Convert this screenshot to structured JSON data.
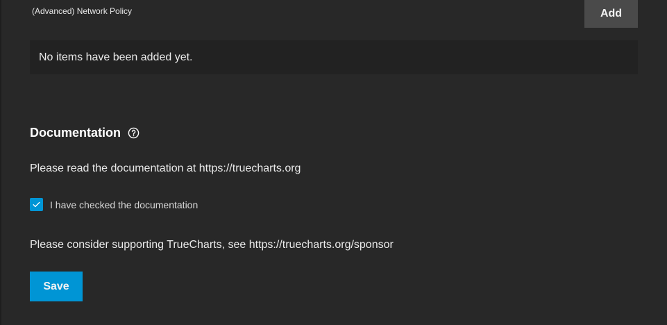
{
  "network_policy": {
    "label": "(Advanced) Network Policy",
    "add_label": "Add",
    "empty_message": "No items have been added yet."
  },
  "documentation": {
    "title": "Documentation",
    "help_icon": "help-circle-icon",
    "read_text": "Please read the documentation at https://truecharts.org",
    "checkbox_label": "I have checked the documentation",
    "checkbox_checked": true,
    "sponsor_text": "Please consider supporting TrueCharts, see https://truecharts.org/sponsor"
  },
  "actions": {
    "save_label": "Save"
  },
  "colors": {
    "accent": "#0095d5",
    "panel_bg": "#282828",
    "page_bg": "#1e1e1e",
    "add_button_bg": "#4a4a4a"
  }
}
